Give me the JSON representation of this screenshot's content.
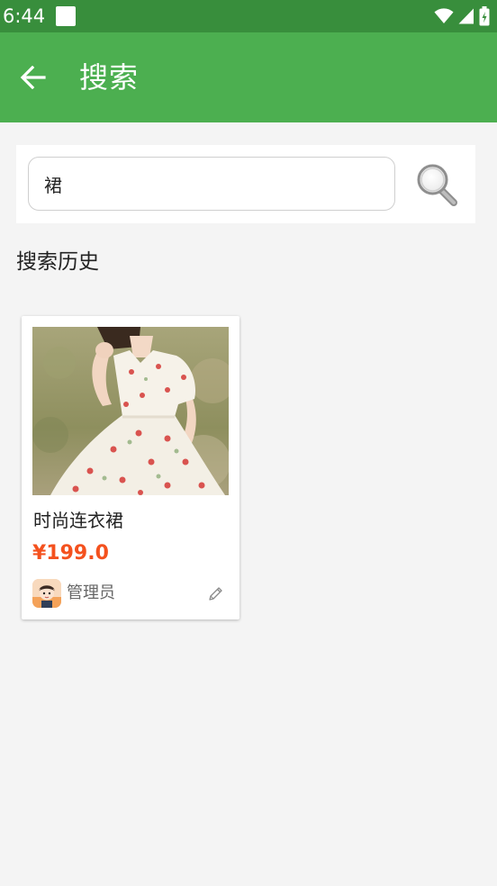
{
  "status_bar": {
    "time": "6:44"
  },
  "app_bar": {
    "title": "搜索",
    "back_icon": "arrow-left-icon"
  },
  "search": {
    "value": "裙",
    "placeholder": "",
    "button_icon": "search-icon"
  },
  "history": {
    "title": "搜索历史"
  },
  "results": [
    {
      "name": "时尚连衣裙",
      "price": "¥199.0",
      "author": "管理员",
      "edit_icon": "pencil-icon"
    }
  ],
  "colors": {
    "status_bar": "#388e3c",
    "app_bar": "#4caf50",
    "price": "#f4511e",
    "background": "#f4f4f4"
  }
}
